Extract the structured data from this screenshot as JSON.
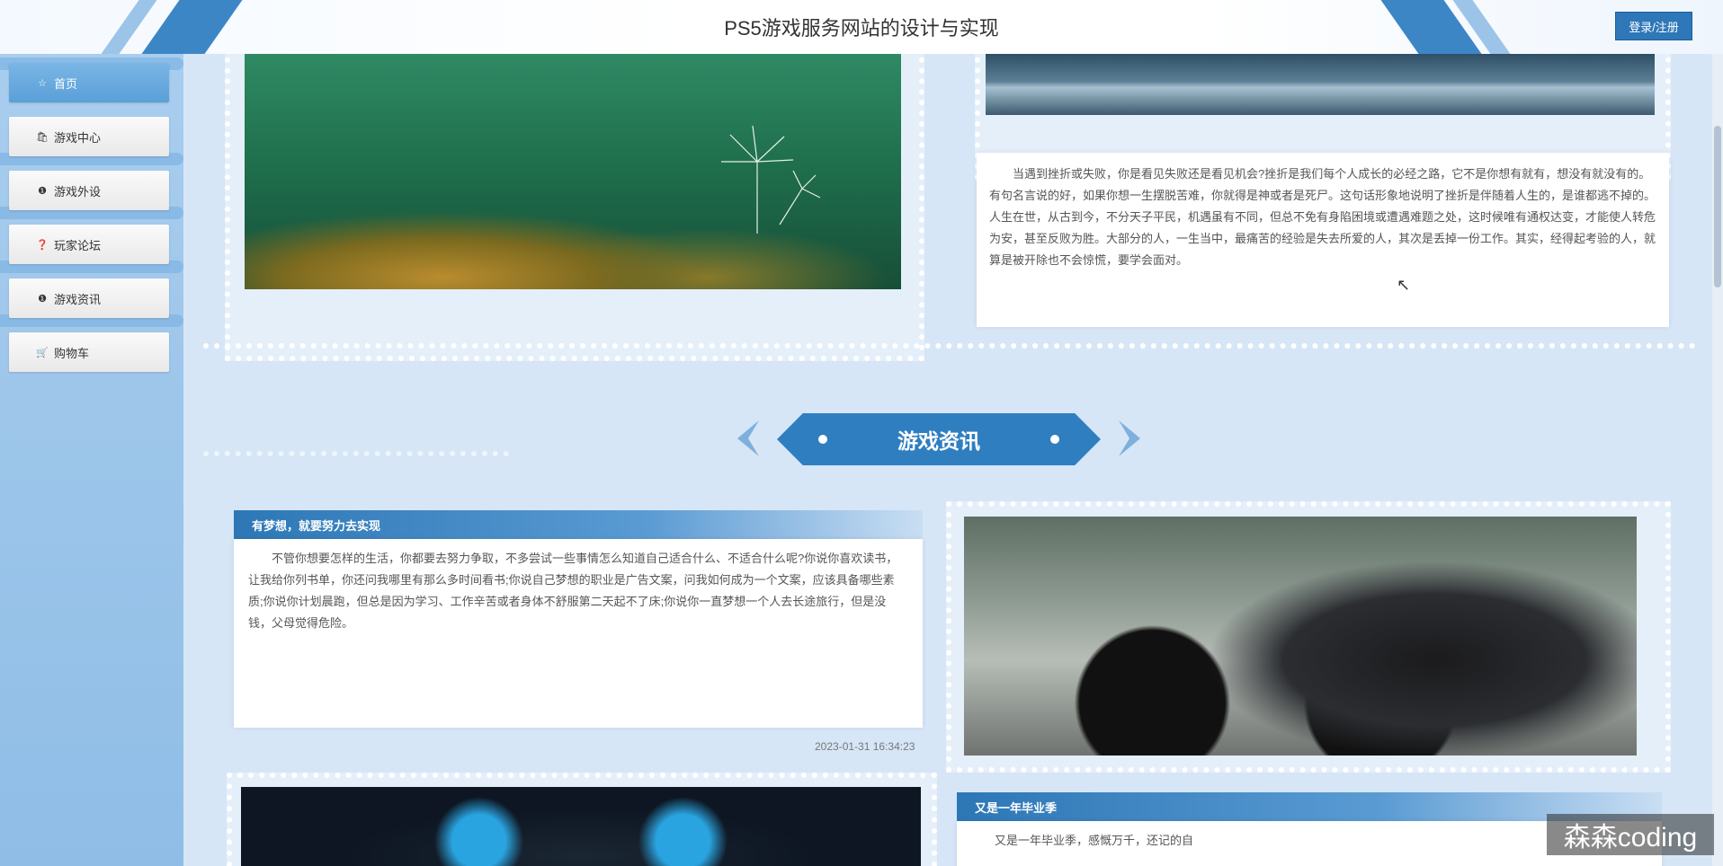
{
  "header": {
    "title": "PS5游戏服务网站的设计与实现",
    "login_label": "登录/注册"
  },
  "sidebar": {
    "items": [
      {
        "label": "首页",
        "icon": "star-icon",
        "active": true
      },
      {
        "label": "游戏中心",
        "icon": "bag-icon",
        "active": false
      },
      {
        "label": "游戏外设",
        "icon": "info-circle-icon",
        "active": false
      },
      {
        "label": "玩家论坛",
        "icon": "question-circle-icon",
        "active": false
      },
      {
        "label": "游戏资讯",
        "icon": "info-circle-icon",
        "active": false
      },
      {
        "label": "购物车",
        "icon": "cart-icon",
        "active": false
      }
    ]
  },
  "intro": {
    "paragraph": "当遇到挫折或失败，你是看见失败还是看见机会?挫折是我们每个人成长的必经之路，它不是你想有就有，想没有就没有的。有句名言说的好，如果你想一生摆脱苦难，你就得是神或者是死尸。这句话形象地说明了挫折是伴随着人生的，是谁都逃不掉的。人生在世，从古到今，不分天子平民，机遇虽有不同，但总不免有身陷困境或遭遇难题之处，这时候唯有通权达变，才能使人转危为安，甚至反败为胜。大部分的人，一生当中，最痛苦的经验是失去所爱的人，其次是丢掉一份工作。其实，经得起考验的人，就算是被开除也不会惊慌，要学会面对。"
  },
  "section": {
    "title": "游戏资讯"
  },
  "news": [
    {
      "title": "有梦想，就要努力去实现",
      "body": "不管你想要怎样的生活，你都要去努力争取，不多尝试一些事情怎么知道自己适合什么、不适合什么呢?你说你喜欢读书，让我给你列书单，你还问我哪里有那么多时间看书;你说自己梦想的职业是广告文案，问我如何成为一个文案，应该具备哪些素质;你说你计划晨跑，但总是因为学习、工作辛苦或者身体不舒服第二天起不了床;你说你一直梦想一个人去长途旅行，但是没钱，父母觉得危险。",
      "date": "2023-01-31 16:34:23"
    },
    {
      "title": "又是一年毕业季",
      "body": "又是一年毕业季，感慨万千，还记的自"
    }
  ],
  "watermark": "森森coding",
  "colors": {
    "accent": "#2f7fc0",
    "sidebar": "#a9cdee",
    "page_bg": "#d6e6f7"
  }
}
